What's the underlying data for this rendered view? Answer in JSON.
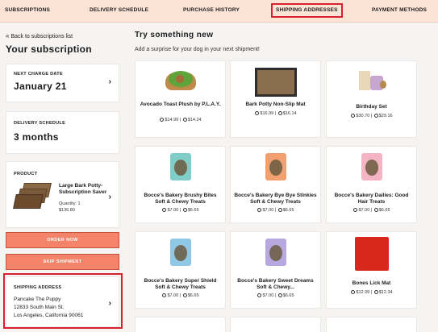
{
  "nav": {
    "items": [
      "SUBSCRIPTIONS",
      "DELIVERY SCHEDULE",
      "PURCHASE HISTORY",
      "SHIPPING ADDRESSES",
      "PAYMENT METHODS"
    ]
  },
  "sidebar": {
    "back_link": "Back to subscriptions list",
    "title": "Your subscription",
    "next_charge": {
      "label": "NEXT CHARGE DATE",
      "value": "January 21"
    },
    "delivery": {
      "label": "DELIVERY SCHEDULE",
      "value": "3 months"
    },
    "product": {
      "label": "PRODUCT",
      "name": "Large Bark Potty-Subscription Saver",
      "quantity": "Quantity: 1",
      "price": "$136.80"
    },
    "order_now": "ORDER NOW",
    "skip_shipment": "SKIP SHIPMENT",
    "shipping": {
      "label": "SHIPPING ADDRESS",
      "name": "Pancake The Puppy",
      "street": "12833 South Main St.",
      "city": "Los Angeles, California 90061"
    }
  },
  "main": {
    "title": "Try something new",
    "subtitle": "Add a surprise for your dog in your next shipment!",
    "products": [
      {
        "name": "Avocado Toast Plush by P.L.A.Y.",
        "price": "$14.99",
        "sub_price": "$14.24",
        "img": "avocado"
      },
      {
        "name": "Bark Potty Non-Slip Mat",
        "price": "$16.99",
        "sub_price": "$16.14",
        "img": "mat"
      },
      {
        "name": "Birthday Set",
        "price": "$30.70",
        "sub_price": "$29.16",
        "img": "birthday"
      },
      {
        "name": "Bocce's Bakery Brushy Bites Soft & Chewy Treats",
        "price": "$7.00",
        "sub_price": "$6.65",
        "img": "bag-teal"
      },
      {
        "name": "Bocce's Bakery Bye Bye Stinkies Soft & Chewy Treats",
        "price": "$7.00",
        "sub_price": "$6.65",
        "img": "bag-orange"
      },
      {
        "name": "Bocce's Bakery Dailies: Good Hair Treats",
        "price": "$7.00",
        "sub_price": "$6.65",
        "img": "bag-pink"
      },
      {
        "name": "Bocce's Bakery Super Shield Soft & Chewy Treats",
        "price": "$7.00",
        "sub_price": "$6.65",
        "img": "bag-blue"
      },
      {
        "name": "Bocce's Bakery Sweet Dreams Soft & Chewy...",
        "price": "$7.00",
        "sub_price": "$6.65",
        "img": "bag-purple"
      },
      {
        "name": "Bones Lick Mat",
        "price": "$12.99",
        "sub_price": "$12.34",
        "img": "lickmat"
      }
    ]
  },
  "colors": {
    "nav_bg": "#fbe3d5",
    "button": "#f38369",
    "highlight": "#d6222e"
  }
}
